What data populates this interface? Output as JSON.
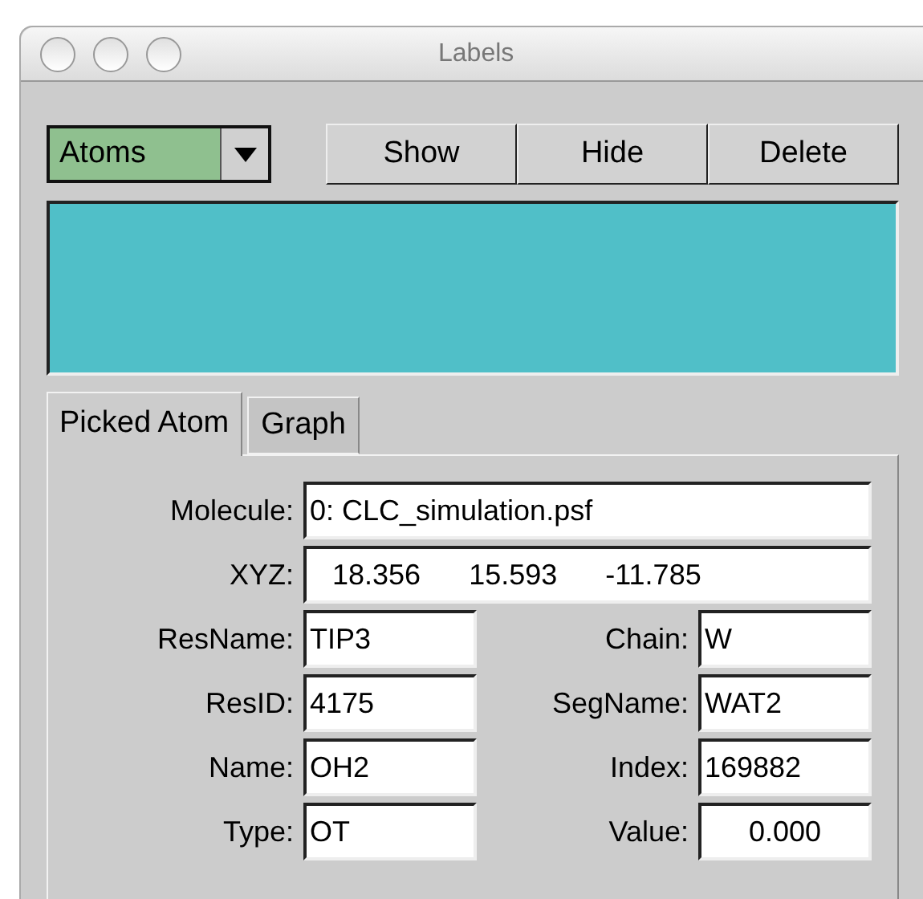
{
  "window": {
    "title": "Labels"
  },
  "category": {
    "value": "Atoms"
  },
  "buttons": [
    "Show",
    "Hide",
    "Delete"
  ],
  "tabs": [
    {
      "label": "Picked Atom",
      "selected": true
    },
    {
      "label": "Graph",
      "selected": false
    }
  ],
  "molecule": {
    "label": "Molecule:",
    "value": "0: CLC_simulation.psf"
  },
  "xyz": {
    "label": "XYZ:",
    "values": [
      "18.356",
      "15.593",
      "-11.785"
    ]
  },
  "fields": [
    {
      "label": "ResName:",
      "value": "TIP3",
      "kind": "text"
    },
    {
      "label": "Chain:",
      "value": "W",
      "kind": "text"
    },
    {
      "label": "ResID:",
      "value": "4175",
      "kind": "text"
    },
    {
      "label": "SegName:",
      "value": "WAT2",
      "kind": "text"
    },
    {
      "label": "Name:",
      "value": "OH2",
      "kind": "text"
    },
    {
      "label": "Index:",
      "value": "169882",
      "kind": "text"
    },
    {
      "label": "Type:",
      "value": "OT",
      "kind": "text"
    },
    {
      "label": "Value:",
      "value": "0.000",
      "kind": "numeric"
    }
  ]
}
